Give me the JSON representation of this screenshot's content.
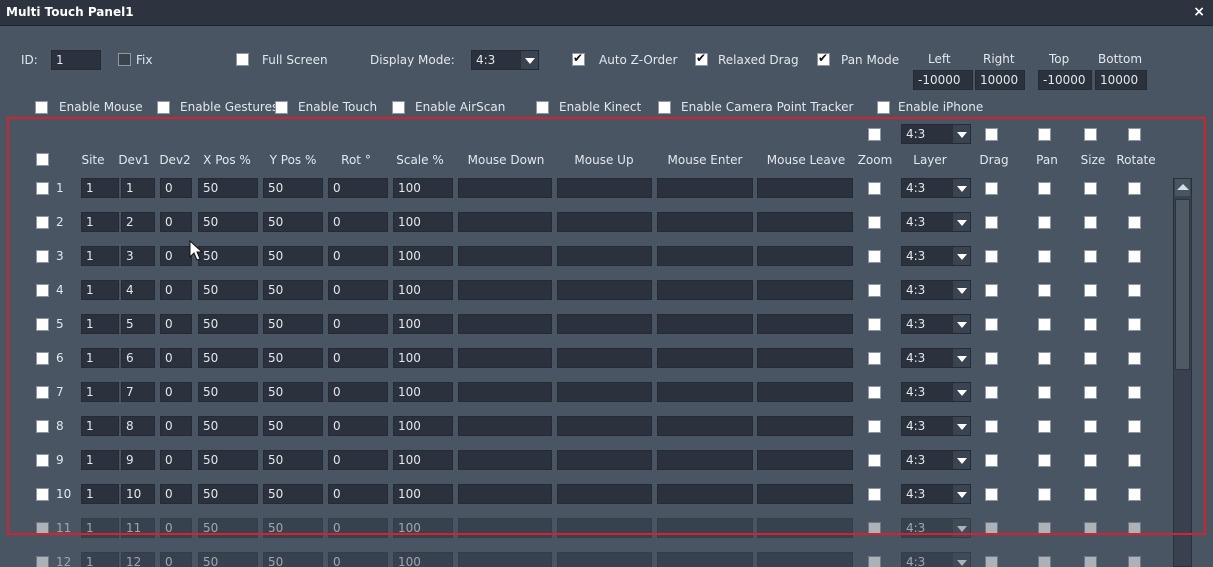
{
  "window": {
    "title": "Multi Touch Panel1",
    "close": "×"
  },
  "top": {
    "id_label": "ID:",
    "id_value": "1",
    "fix_label": "Fix",
    "fullscreen_label": "Full Screen",
    "display_mode_label": "Display Mode:",
    "display_mode_value": "4:3",
    "auto_z_label": "Auto Z-Order",
    "relaxed_drag_label": "Relaxed Drag",
    "pan_mode_label": "Pan Mode",
    "bounds": {
      "left_label": "Left",
      "left_value": "-10000",
      "right_label": "Right",
      "right_value": "10000",
      "top_label": "Top",
      "top_value": "-10000",
      "bottom_label": "Bottom",
      "bottom_value": "10000"
    }
  },
  "enables": [
    "Enable Mouse",
    "Enable Gestures",
    "Enable Touch",
    "Enable AirScan",
    "Enable Kinect",
    "Enable Camera Point Tracker",
    "Enable iPhone"
  ],
  "table": {
    "header_layer_value": "4:3",
    "columns": [
      "Site",
      "Dev1",
      "Dev2",
      "X Pos %",
      "Y Pos %",
      "Rot °",
      "Scale %",
      "Mouse Down",
      "Mouse Up",
      "Mouse Enter",
      "Mouse Leave",
      "Zoom",
      "Layer",
      "Drag",
      "Pan",
      "Size",
      "Rotate"
    ],
    "rows": [
      {
        "n": "1",
        "site": "1",
        "dev1": "1",
        "dev2": "0",
        "x": "50",
        "y": "50",
        "rot": "0",
        "scale": "100",
        "layer": "4:3"
      },
      {
        "n": "2",
        "site": "1",
        "dev1": "2",
        "dev2": "0",
        "x": "50",
        "y": "50",
        "rot": "0",
        "scale": "100",
        "layer": "4:3"
      },
      {
        "n": "3",
        "site": "1",
        "dev1": "3",
        "dev2": "0",
        "x": "50",
        "y": "50",
        "rot": "0",
        "scale": "100",
        "layer": "4:3"
      },
      {
        "n": "4",
        "site": "1",
        "dev1": "4",
        "dev2": "0",
        "x": "50",
        "y": "50",
        "rot": "0",
        "scale": "100",
        "layer": "4:3"
      },
      {
        "n": "5",
        "site": "1",
        "dev1": "5",
        "dev2": "0",
        "x": "50",
        "y": "50",
        "rot": "0",
        "scale": "100",
        "layer": "4:3"
      },
      {
        "n": "6",
        "site": "1",
        "dev1": "6",
        "dev2": "0",
        "x": "50",
        "y": "50",
        "rot": "0",
        "scale": "100",
        "layer": "4:3"
      },
      {
        "n": "7",
        "site": "1",
        "dev1": "7",
        "dev2": "0",
        "x": "50",
        "y": "50",
        "rot": "0",
        "scale": "100",
        "layer": "4:3"
      },
      {
        "n": "8",
        "site": "1",
        "dev1": "8",
        "dev2": "0",
        "x": "50",
        "y": "50",
        "rot": "0",
        "scale": "100",
        "layer": "4:3"
      },
      {
        "n": "9",
        "site": "1",
        "dev1": "9",
        "dev2": "0",
        "x": "50",
        "y": "50",
        "rot": "0",
        "scale": "100",
        "layer": "4:3"
      },
      {
        "n": "10",
        "site": "1",
        "dev1": "10",
        "dev2": "0",
        "x": "50",
        "y": "50",
        "rot": "0",
        "scale": "100",
        "layer": "4:3"
      },
      {
        "n": "11",
        "site": "1",
        "dev1": "11",
        "dev2": "0",
        "x": "50",
        "y": "50",
        "rot": "0",
        "scale": "100",
        "layer": "4:3"
      },
      {
        "n": "12",
        "site": "1",
        "dev1": "12",
        "dev2": "0",
        "x": "50",
        "y": "50",
        "rot": "0",
        "scale": "100",
        "layer": "4:3"
      }
    ]
  },
  "colors": {
    "background": "#4a5563",
    "field": "#2b323d",
    "titlebar": "#2d3440",
    "highlight": "#d3242b"
  }
}
